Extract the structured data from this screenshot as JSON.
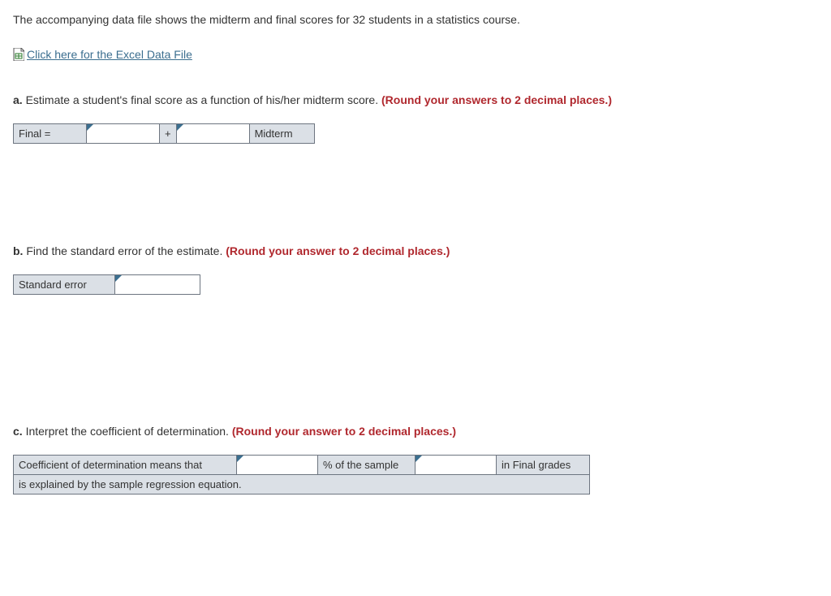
{
  "intro": "The accompanying data file shows the midterm and final scores for 32 students in a statistics course.",
  "fileLink": "Click here for the Excel Data File",
  "a": {
    "label": "a.",
    "prompt": "Estimate a student's final score as a function of his/her midterm score.",
    "round": "(Round your answers to 2 decimal places.)",
    "finalEq": "Final =",
    "plus": "+",
    "midterm": "Midterm",
    "intercept": "",
    "slope": ""
  },
  "b": {
    "label": "b.",
    "prompt": "Find the standard error of the estimate.",
    "round": "(Round your answer to 2 decimal places.)",
    "stdErrLabel": "Standard error",
    "stdErr": ""
  },
  "c": {
    "label": "c.",
    "prompt": "Interpret the coefficient of determination.",
    "round": "(Round your answer to 2 decimal places.)",
    "text1": "Coefficient of determination means that",
    "text2": "% of the sample",
    "text3": "in Final grades",
    "text4": "is explained by the sample regression equation.",
    "pct": "",
    "select": ""
  }
}
